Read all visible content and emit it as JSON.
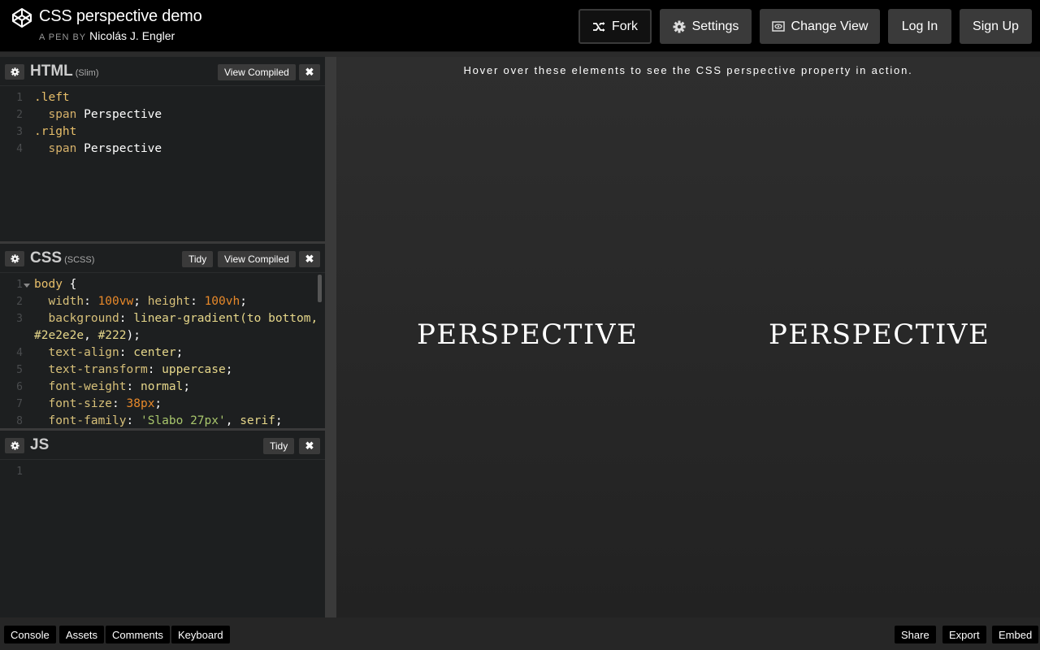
{
  "header": {
    "title": "CSS perspective demo",
    "byline_prefix": "A PEN BY",
    "author": "Nicolás J. Engler",
    "buttons": {
      "fork": "Fork",
      "settings": "Settings",
      "change_view": "Change View",
      "login": "Log In",
      "signup": "Sign Up"
    }
  },
  "editors": {
    "html": {
      "name": "HTML",
      "preprocessor": "(Slim)",
      "view_compiled": "View Compiled",
      "lines": [
        {
          "n": "1",
          "parts": [
            [
              ".left",
              "c-sel"
            ]
          ]
        },
        {
          "n": "2",
          "parts": [
            [
              "  span ",
              "c-tag"
            ],
            [
              "Perspective",
              "c-white"
            ]
          ]
        },
        {
          "n": "3",
          "parts": [
            [
              ".right",
              "c-sel"
            ]
          ]
        },
        {
          "n": "4",
          "parts": [
            [
              "  span ",
              "c-tag"
            ],
            [
              "Perspective",
              "c-white"
            ]
          ]
        }
      ]
    },
    "css": {
      "name": "CSS",
      "preprocessor": "(SCSS)",
      "tidy": "Tidy",
      "view_compiled": "View Compiled",
      "lines": [
        {
          "n": "1",
          "parts": [
            [
              "body ",
              "c-sel"
            ],
            [
              "{",
              "c-white"
            ]
          ]
        },
        {
          "n": "2",
          "parts": [
            [
              "  width",
              "c-prop"
            ],
            [
              ": ",
              "c-white"
            ],
            [
              "100vw",
              "c-num"
            ],
            [
              "; ",
              "c-white"
            ],
            [
              "height",
              "c-prop"
            ],
            [
              ": ",
              "c-white"
            ],
            [
              "100vh",
              "c-num"
            ],
            [
              ";",
              "c-white"
            ]
          ]
        },
        {
          "n": "3",
          "parts": [
            [
              "  background",
              "c-prop"
            ],
            [
              ": ",
              "c-white"
            ],
            [
              "linear-gradient(to bottom,",
              "c-kw"
            ]
          ]
        },
        {
          "n": "",
          "parts": [
            [
              "#2e2e2e",
              "c-kw"
            ],
            [
              ", ",
              "c-white"
            ],
            [
              "#222",
              "c-kw"
            ],
            [
              ");",
              "c-white"
            ]
          ]
        },
        {
          "n": "4",
          "parts": [
            [
              "  text-align",
              "c-prop"
            ],
            [
              ": ",
              "c-white"
            ],
            [
              "center",
              "c-kw"
            ],
            [
              ";",
              "c-white"
            ]
          ]
        },
        {
          "n": "5",
          "parts": [
            [
              "  text-transform",
              "c-prop"
            ],
            [
              ": ",
              "c-white"
            ],
            [
              "uppercase",
              "c-kw"
            ],
            [
              ";",
              "c-white"
            ]
          ]
        },
        {
          "n": "6",
          "parts": [
            [
              "  font-weight",
              "c-prop"
            ],
            [
              ": ",
              "c-white"
            ],
            [
              "normal",
              "c-kw"
            ],
            [
              ";",
              "c-white"
            ]
          ]
        },
        {
          "n": "7",
          "parts": [
            [
              "  font-size",
              "c-prop"
            ],
            [
              ": ",
              "c-white"
            ],
            [
              "38px",
              "c-num"
            ],
            [
              ";",
              "c-white"
            ]
          ]
        },
        {
          "n": "8",
          "parts": [
            [
              "  font-family",
              "c-prop"
            ],
            [
              ": ",
              "c-white"
            ],
            [
              "'Slabo 27px'",
              "c-str"
            ],
            [
              ", ",
              "c-white"
            ],
            [
              "serif",
              "c-kw"
            ],
            [
              ";",
              "c-white"
            ]
          ]
        }
      ]
    },
    "js": {
      "name": "JS",
      "tidy": "Tidy",
      "lines": [
        {
          "n": "1",
          "parts": []
        }
      ]
    }
  },
  "preview": {
    "hint": "Hover over these elements to see the CSS perspective property in action.",
    "left_text": "PERSPECTIVE",
    "right_text": "PERSPECTIVE"
  },
  "footer": {
    "left": [
      "Console",
      "Assets",
      "Comments",
      "Keyboard"
    ],
    "right": [
      "Share",
      "Export",
      "Embed"
    ]
  },
  "icons": {
    "logo": "codepen-logo-icon",
    "fork": "fork-icon",
    "settings": "gear-icon",
    "change_view": "change-view-icon",
    "close": "close-icon"
  }
}
